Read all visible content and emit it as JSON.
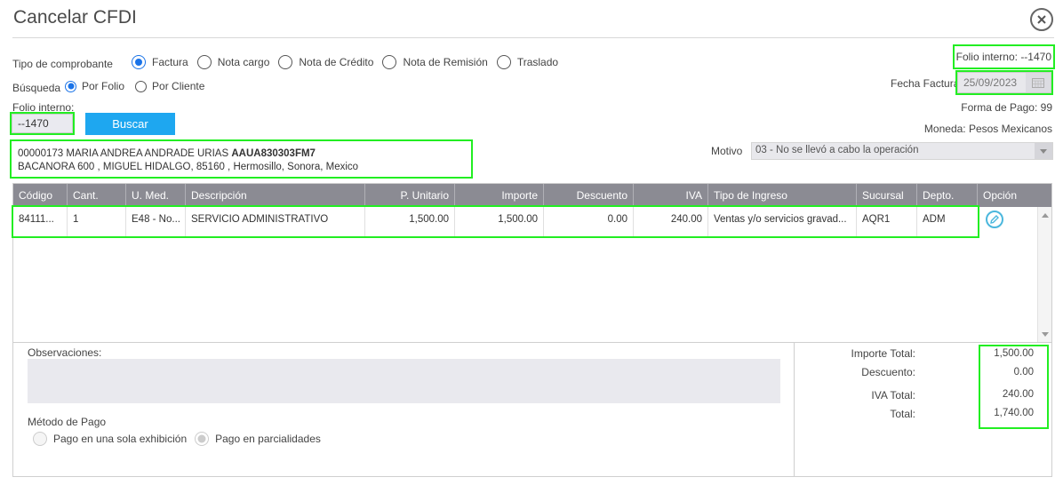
{
  "title": "Cancelar CFDI",
  "tipo_comprobante": {
    "label": "Tipo de comprobante",
    "options": [
      "Factura",
      "Nota cargo",
      "Nota de Crédito",
      "Nota de Remisión",
      "Traslado"
    ],
    "selected": "Factura"
  },
  "busqueda": {
    "label": "Búsqueda",
    "options": [
      "Por Folio",
      "Por Cliente"
    ],
    "selected": "Por Folio"
  },
  "folio": {
    "label": "Folio interno:",
    "value": "--1470",
    "search_button": "Buscar"
  },
  "client": {
    "line1_prefix": "00000173 MARIA ANDREA ANDRADE URIAS",
    "rfc": "AAUA830303FM7",
    "line2": "BACANORA 600 , MIGUEL HIDALGO, 85160 , Hermosillo, Sonora, Mexico"
  },
  "info": {
    "folio_interno": "Folio interno: --1470",
    "fecha_label": "Fecha Factura:",
    "fecha_value": "25/09/2023",
    "forma_pago": "Forma de Pago: 99",
    "moneda": "Moneda: Pesos Mexicanos",
    "motivo_label": "Motivo",
    "motivo_value": "03 - No se llevó a cabo la operación"
  },
  "table": {
    "headers": [
      "Código",
      "Cant.",
      "U. Med.",
      "Descripción",
      "P. Unitario",
      "Importe",
      "Descuento",
      "IVA",
      "Tipo de Ingreso",
      "Sucursal",
      "Depto.",
      "Opción"
    ],
    "rows": [
      [
        "84111...",
        "1",
        "E48 - No...",
        "SERVICIO ADMINISTRATIVO",
        "1,500.00",
        "1,500.00",
        "0.00",
        "240.00",
        "Ventas y/o servicios gravad...",
        "AQR1",
        "ADM"
      ]
    ]
  },
  "observaciones_label": "Observaciones:",
  "metodo_pago": {
    "label": "Método de Pago",
    "options": [
      "Pago en una sola exhibición",
      "Pago en parcialidades"
    ],
    "selected": "Pago en parcialidades"
  },
  "totals": {
    "importe_label": "Importe Total:",
    "importe_value": "1,500.00",
    "descuento_label": "Descuento:",
    "descuento_value": "0.00",
    "iva_label": "IVA Total:",
    "iva_value": "240.00",
    "total_label": "Total:",
    "total_value": "1,740.00"
  },
  "colors": {
    "accent": "#1ea7f0",
    "header_gray": "#8b8b93",
    "highlight": "#22ee22"
  }
}
